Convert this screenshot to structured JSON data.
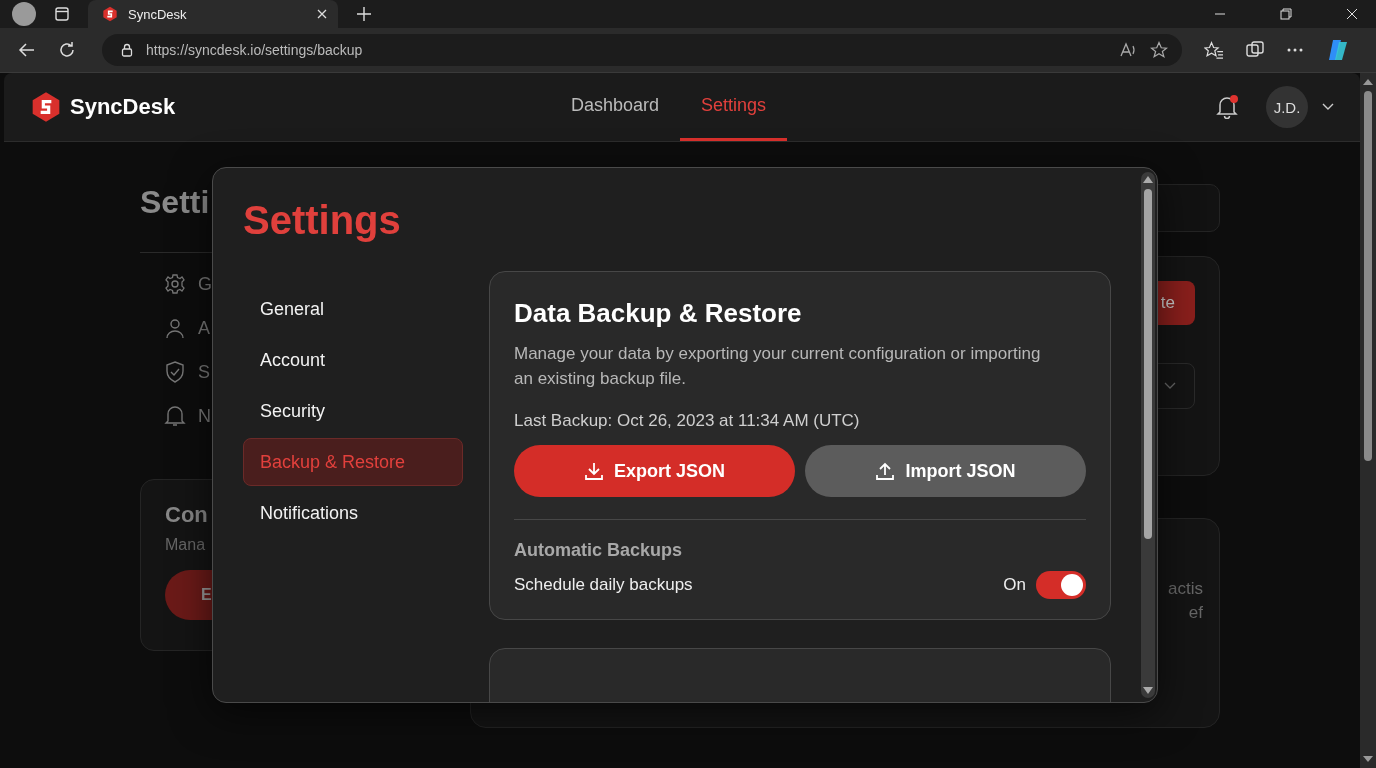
{
  "browser": {
    "tab_title": "SyncDesk",
    "url": "https://syncdesk.io/settings/backup"
  },
  "header": {
    "brand": "SyncDesk",
    "nav": [
      {
        "label": "Dashboard",
        "selected": false
      },
      {
        "label": "Settings",
        "selected": true
      }
    ],
    "notifications_unread": true,
    "avatar": "J.D."
  },
  "background_page": {
    "title": "Setti",
    "nav": [
      {
        "kind": "gear",
        "label": "G"
      },
      {
        "kind": "person",
        "label": "A"
      },
      {
        "kind": "shield",
        "label": "S"
      },
      {
        "kind": "bell",
        "label": "N"
      }
    ],
    "card": {
      "title": "Con",
      "text": "Mana",
      "button": "E"
    },
    "side_button": "te",
    "side_text": [
      "actis",
      "ef"
    ]
  },
  "modal": {
    "title": "Settings",
    "nav": [
      {
        "label": "General",
        "selected": false
      },
      {
        "label": "Account",
        "selected": false
      },
      {
        "label": "Security",
        "selected": false
      },
      {
        "label": "Backup & Restore",
        "selected": true
      },
      {
        "label": "Notifications",
        "selected": false
      }
    ],
    "section": {
      "title": "Data Backup & Restore",
      "description": "Manage your data by exporting your current configuration or importing an existing backup file.",
      "last_backup": "Last Backup: Oct 26, 2023 at 11:34 AM (UTC)",
      "buttons": [
        {
          "label": "Export JSON",
          "kind": "primary"
        },
        {
          "label": "Import JSON",
          "kind": "secondary"
        }
      ],
      "automatic": {
        "heading": "Automatic Backups",
        "label": "Schedule daily backups",
        "state_text": "On",
        "on": true
      }
    }
  }
}
